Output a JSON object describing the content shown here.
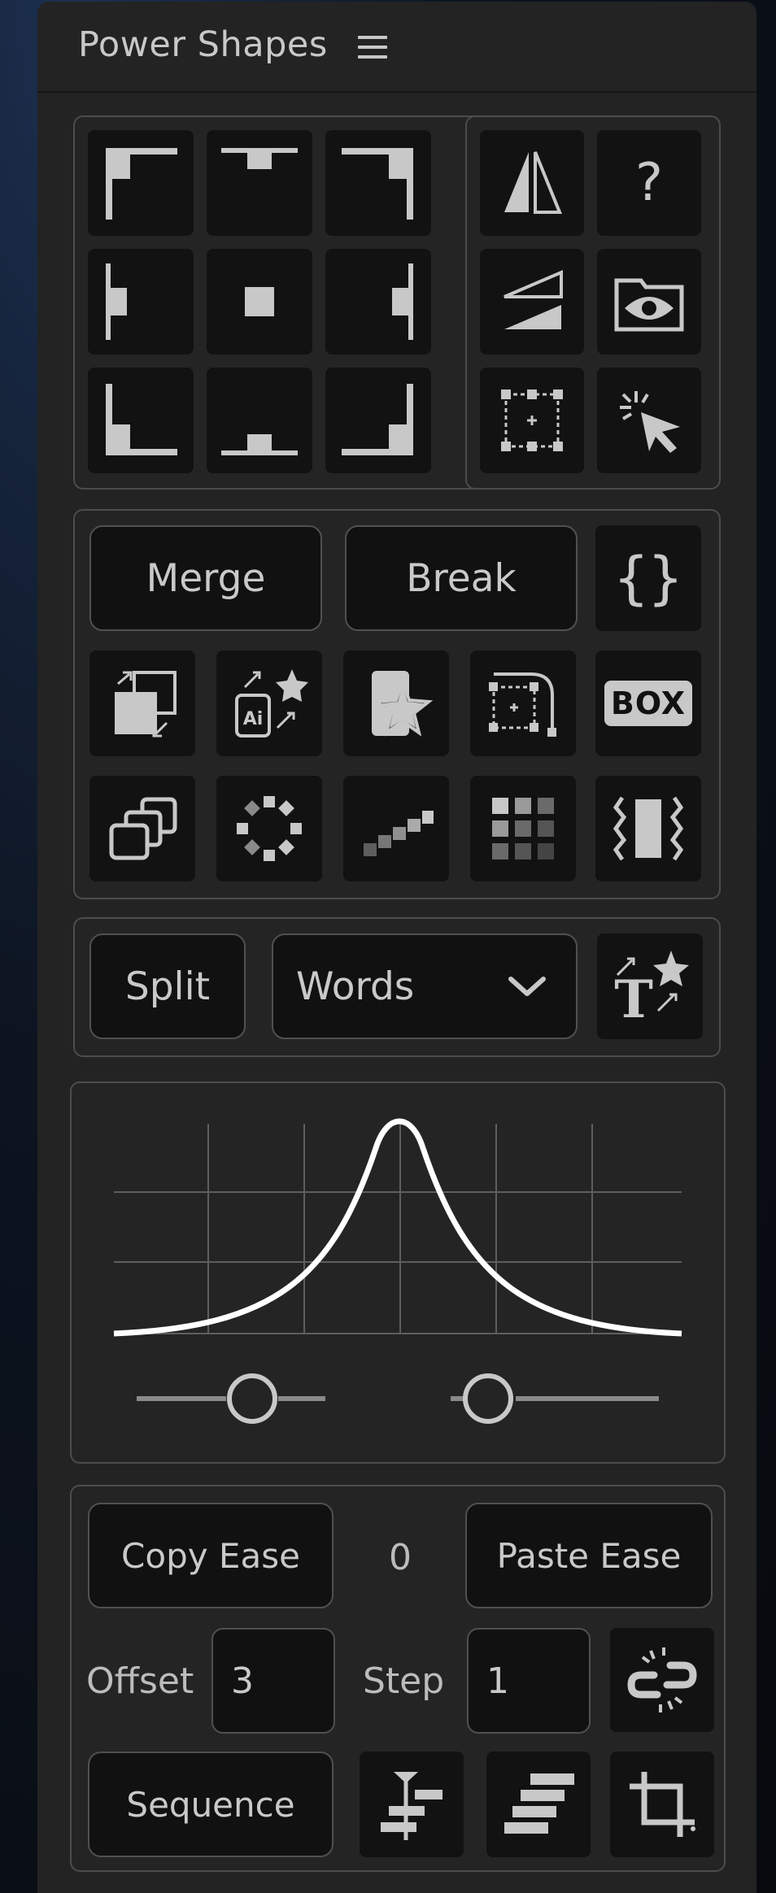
{
  "panel": {
    "title": "Power Shapes",
    "menu_icon": "hamburger-menu-icon"
  },
  "anchor_grid": {
    "icons": [
      "anchor-top-left-icon",
      "anchor-top-center-icon",
      "anchor-top-right-icon",
      "anchor-middle-left-icon",
      "anchor-center-icon",
      "anchor-middle-right-icon",
      "anchor-bottom-left-icon",
      "anchor-bottom-center-icon",
      "anchor-bottom-right-icon"
    ]
  },
  "tools": {
    "icons": [
      "flip-horizontal-icon",
      "help-question-icon",
      "flip-vertical-icon",
      "reveal-folder-eye-icon",
      "bounding-box-anchor-icon",
      "select-click-icon"
    ]
  },
  "merge_group": {
    "merge_label": "Merge",
    "break_label": "Break",
    "expression_icon": "curly-braces-icon",
    "row1_icons": [
      "resize-layer-icon",
      "import-ai-icon",
      "shape-star-layer-icon",
      "bezier-bounding-icon"
    ],
    "box_icon_text": "BOX",
    "row2_icons": [
      "duplicate-stack-icon",
      "radial-repeat-icon",
      "stair-step-icon",
      "grid-repeat-icon",
      "wiggle-box-icon"
    ]
  },
  "split_group": {
    "split_label": "Split",
    "mode_value": "Words",
    "dropdown_icon": "chevron-down-icon",
    "text_anim_icon": "text-animate-icon"
  },
  "ease": {
    "curve_icon": "ease-curve-graph",
    "handle_left": "ease-in-slider",
    "handle_right": "ease-out-slider"
  },
  "ease_controls": {
    "copy_label": "Copy Ease",
    "value": "0",
    "paste_label": "Paste Ease",
    "offset_label": "Offset",
    "offset_value": "3",
    "step_label": "Step",
    "step_value": "1",
    "link_icon": "broken-link-icon",
    "sequence_label": "Sequence",
    "align_icons": [
      "sequence-align-icon",
      "stagger-layers-icon",
      "trim-crop-icon"
    ]
  },
  "colors": {
    "panel_bg": "#232323",
    "tile_bg": "#121212",
    "icon": "#c8c8c8",
    "border": "#4c4c4c"
  }
}
